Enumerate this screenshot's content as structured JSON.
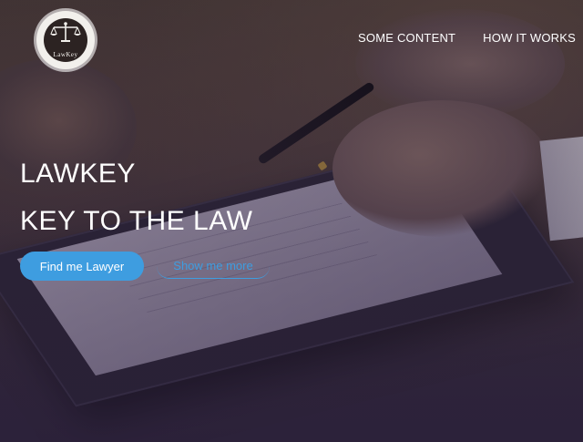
{
  "brand": {
    "logo_text": "LawKey",
    "logo_icon": "scales-of-justice-icon"
  },
  "nav": {
    "items": [
      {
        "label": "SOME CONTENT"
      },
      {
        "label": "HOW IT WORKS"
      }
    ]
  },
  "hero": {
    "title_line1": "LAWKEY",
    "title_line2": "KEY TO THE LAW",
    "primary_button": "Find me Lawyer",
    "secondary_button": "Show me more"
  },
  "colors": {
    "accent": "#3e9de0",
    "overlay": "#2d233c",
    "text": "#ffffff"
  }
}
